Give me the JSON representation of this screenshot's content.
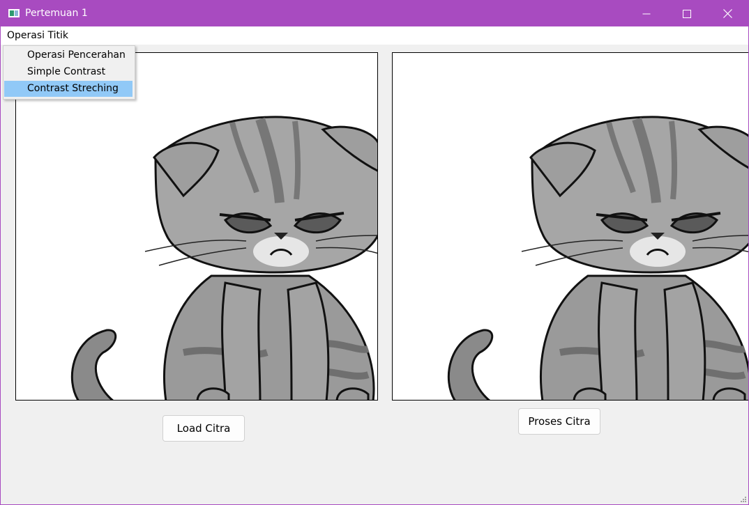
{
  "window": {
    "title": "Pertemuan 1",
    "accent_color": "#a84bc0"
  },
  "titlebar_buttons": [
    "minimize-icon",
    "maximize-icon",
    "close-icon"
  ],
  "menubar": {
    "menu_label": "Operasi Titik"
  },
  "dropdown": {
    "items": [
      "Operasi Pencerahan",
      "Simple Contrast",
      "Contrast Streching"
    ],
    "highlighted_index": 2,
    "highlight_color": "#91c9f7"
  },
  "images": {
    "left": "grumpy-cat-grayscale",
    "right": "grumpy-cat-grayscale-processed"
  },
  "buttons": {
    "load": "Load Citra",
    "proses": "Proses Citra"
  }
}
